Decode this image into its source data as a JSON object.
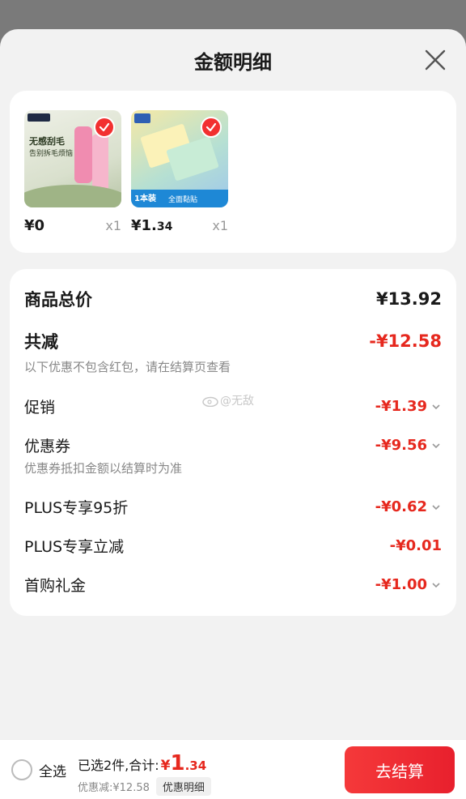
{
  "header": {
    "title": "金额明细"
  },
  "products": [
    {
      "thumb_top": "无感刮毛",
      "thumb_mid": "告别拆毛烦恼",
      "price": "¥0",
      "qty": "x1"
    },
    {
      "thumb_top": "全面黏贴",
      "thumb_mid": "1本装",
      "price_main": "¥1.",
      "price_dec": "34",
      "qty": "x1"
    }
  ],
  "details": {
    "total_label": "商品总价",
    "total_value": "¥13.92",
    "reduce_label": "共减",
    "reduce_value": "-¥12.58",
    "reduce_note": "以下优惠不包含红包，请在结算页查看",
    "items": [
      {
        "label": "促销",
        "value": "-¥1.39",
        "expandable": true
      },
      {
        "label": "优惠券",
        "value": "-¥9.56",
        "expandable": true,
        "note": "优惠券抵扣金额以结算时为准"
      },
      {
        "label": "PLUS专享95折",
        "value": "-¥0.62",
        "expandable": true
      },
      {
        "label": "PLUS专享立减",
        "value": "-¥0.01",
        "expandable": false
      },
      {
        "label": "首购礼金",
        "value": "-¥1.00",
        "expandable": true
      }
    ],
    "watermark": "@无敌"
  },
  "bottom": {
    "select_all": "全选",
    "selected_text": "已选2件,合计:",
    "total_symbol": "¥",
    "total_int": "1",
    "total_dec": ".34",
    "discount": "优惠减:¥12.58",
    "detail_button": "优惠明细",
    "checkout": "去结算"
  },
  "colors": {
    "accent": "#e6281e",
    "checkout_bg": "#f23030"
  }
}
